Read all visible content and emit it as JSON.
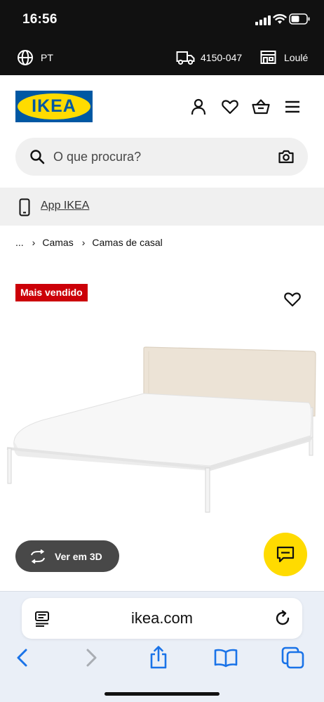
{
  "status_bar": {
    "time": "16:56"
  },
  "locale_bar": {
    "language": "PT",
    "postal_code": "4150-047",
    "store": "Loulé"
  },
  "header": {
    "logo_text": "IKEA"
  },
  "search": {
    "placeholder": "O que procura?"
  },
  "app_bar": {
    "label": "App IKEA"
  },
  "breadcrumb": {
    "ellipsis": "...",
    "items": [
      "Camas",
      "Camas de casal"
    ]
  },
  "product": {
    "badge": "Mais vendido",
    "view_3d_label": "Ver em 3D"
  },
  "browser": {
    "url": "ikea.com"
  },
  "colors": {
    "ikea_blue": "#0058a3",
    "ikea_yellow": "#ffdb00",
    "badge_red": "#cc0008",
    "safari_blue": "#1a73e8"
  },
  "icons": [
    "globe-icon",
    "truck-icon",
    "store-icon",
    "user-icon",
    "heart-icon",
    "basket-icon",
    "menu-icon",
    "search-icon",
    "camera-icon",
    "phone-icon",
    "rotate-3d-icon",
    "chat-icon",
    "reader-icon",
    "reload-icon",
    "back-icon",
    "forward-icon",
    "share-icon",
    "bookmarks-icon",
    "tabs-icon"
  ]
}
